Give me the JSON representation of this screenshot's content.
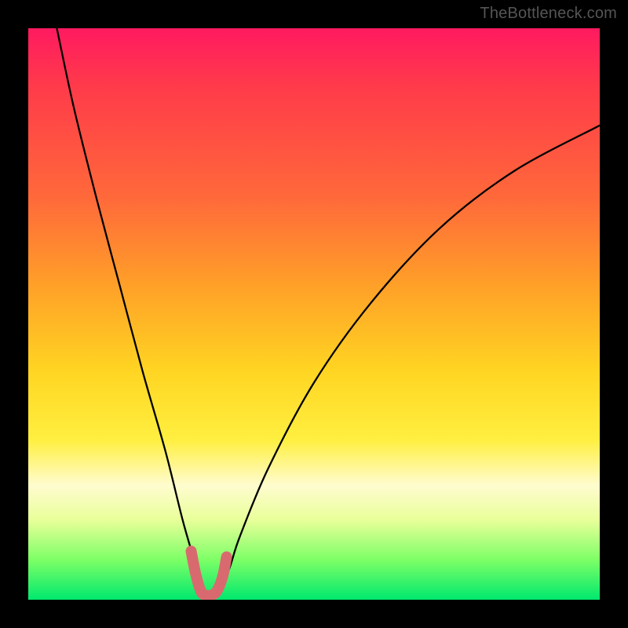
{
  "watermark": {
    "text": "TheBottleneck.com"
  },
  "chart_data": {
    "type": "line",
    "title": "",
    "xlabel": "",
    "ylabel": "",
    "xlim": [
      0,
      100
    ],
    "ylim": [
      0,
      100
    ],
    "series": [
      {
        "name": "bottleneck-curve",
        "x": [
          5,
          8,
          12,
          16,
          20,
          24,
          27,
          29,
          30,
          31,
          32,
          33,
          35,
          37,
          42,
          50,
          60,
          72,
          85,
          100
        ],
        "y": [
          100,
          86,
          70,
          55,
          40,
          26,
          14,
          7,
          3,
          1,
          1,
          2,
          5,
          11,
          23,
          38,
          52,
          65,
          75,
          83
        ]
      },
      {
        "name": "highlight-segment",
        "x": [
          28.5,
          29.3,
          30.2,
          31.0,
          32.0,
          33.0,
          34.0,
          34.7
        ],
        "y": [
          8.5,
          4.5,
          1.5,
          0.8,
          0.8,
          1.5,
          4.0,
          7.5
        ]
      }
    ],
    "background_gradient": {
      "stops": [
        {
          "pos": 0.0,
          "color": "#ff1a60"
        },
        {
          "pos": 0.1,
          "color": "#ff3a4a"
        },
        {
          "pos": 0.3,
          "color": "#ff6a3a"
        },
        {
          "pos": 0.45,
          "color": "#ffa028"
        },
        {
          "pos": 0.6,
          "color": "#ffd522"
        },
        {
          "pos": 0.72,
          "color": "#ffef40"
        },
        {
          "pos": 0.8,
          "color": "#fffccf"
        },
        {
          "pos": 0.86,
          "color": "#e9ff9a"
        },
        {
          "pos": 0.93,
          "color": "#7dff66"
        },
        {
          "pos": 1.0,
          "color": "#00e86e"
        }
      ]
    },
    "annotations": [
      {
        "text": "TheBottleneck.com",
        "position": "top-right"
      }
    ]
  }
}
